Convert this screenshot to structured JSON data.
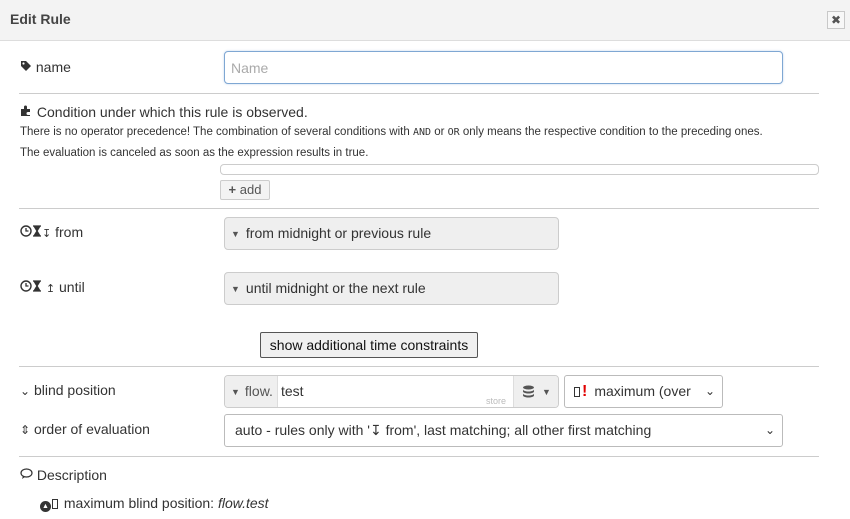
{
  "dialog": {
    "title": "Edit Rule",
    "close_glyph": "✖"
  },
  "name": {
    "label": "name",
    "placeholder": "Name",
    "value": "",
    "icon": "tag-icon"
  },
  "condition": {
    "title": "Condition under which this rule is observed.",
    "text1_before": "There is no operator precedence! The combination of several conditions with ",
    "text1_and": "AND",
    "text1_mid": " or ",
    "text1_or": "OR",
    "text1_after": " only means the respective condition to the preceding ones.",
    "text2": "The evaluation is canceled as soon as the expression results in true.",
    "add_label": "add",
    "add_glyph": "+",
    "icon": "puzzle-icon"
  },
  "from": {
    "label": "from",
    "glyph": "↧",
    "value": "from midnight or previous rule"
  },
  "until": {
    "label": "until",
    "glyph": "↥",
    "value": "until midnight or the next rule"
  },
  "time_constraints_button": "show additional time constraints",
  "blind_position": {
    "label": "blind position",
    "label_glyph": "⌄",
    "type": "flow.",
    "value": "test",
    "store_hint": "store",
    "mode": "maximum (over"
  },
  "order": {
    "label": "order of evaluation",
    "label_glyph": "⇕",
    "value": "auto - rules only with '↧ from', last matching; all other first matching"
  },
  "description": {
    "label": "Description",
    "icon": "comment-icon",
    "summary_prefix": "maximum blind position: ",
    "summary_value": "flow.test"
  },
  "colors": {
    "accent": "#7fa7d3",
    "danger": "#e00000",
    "panel": "#efefef"
  }
}
